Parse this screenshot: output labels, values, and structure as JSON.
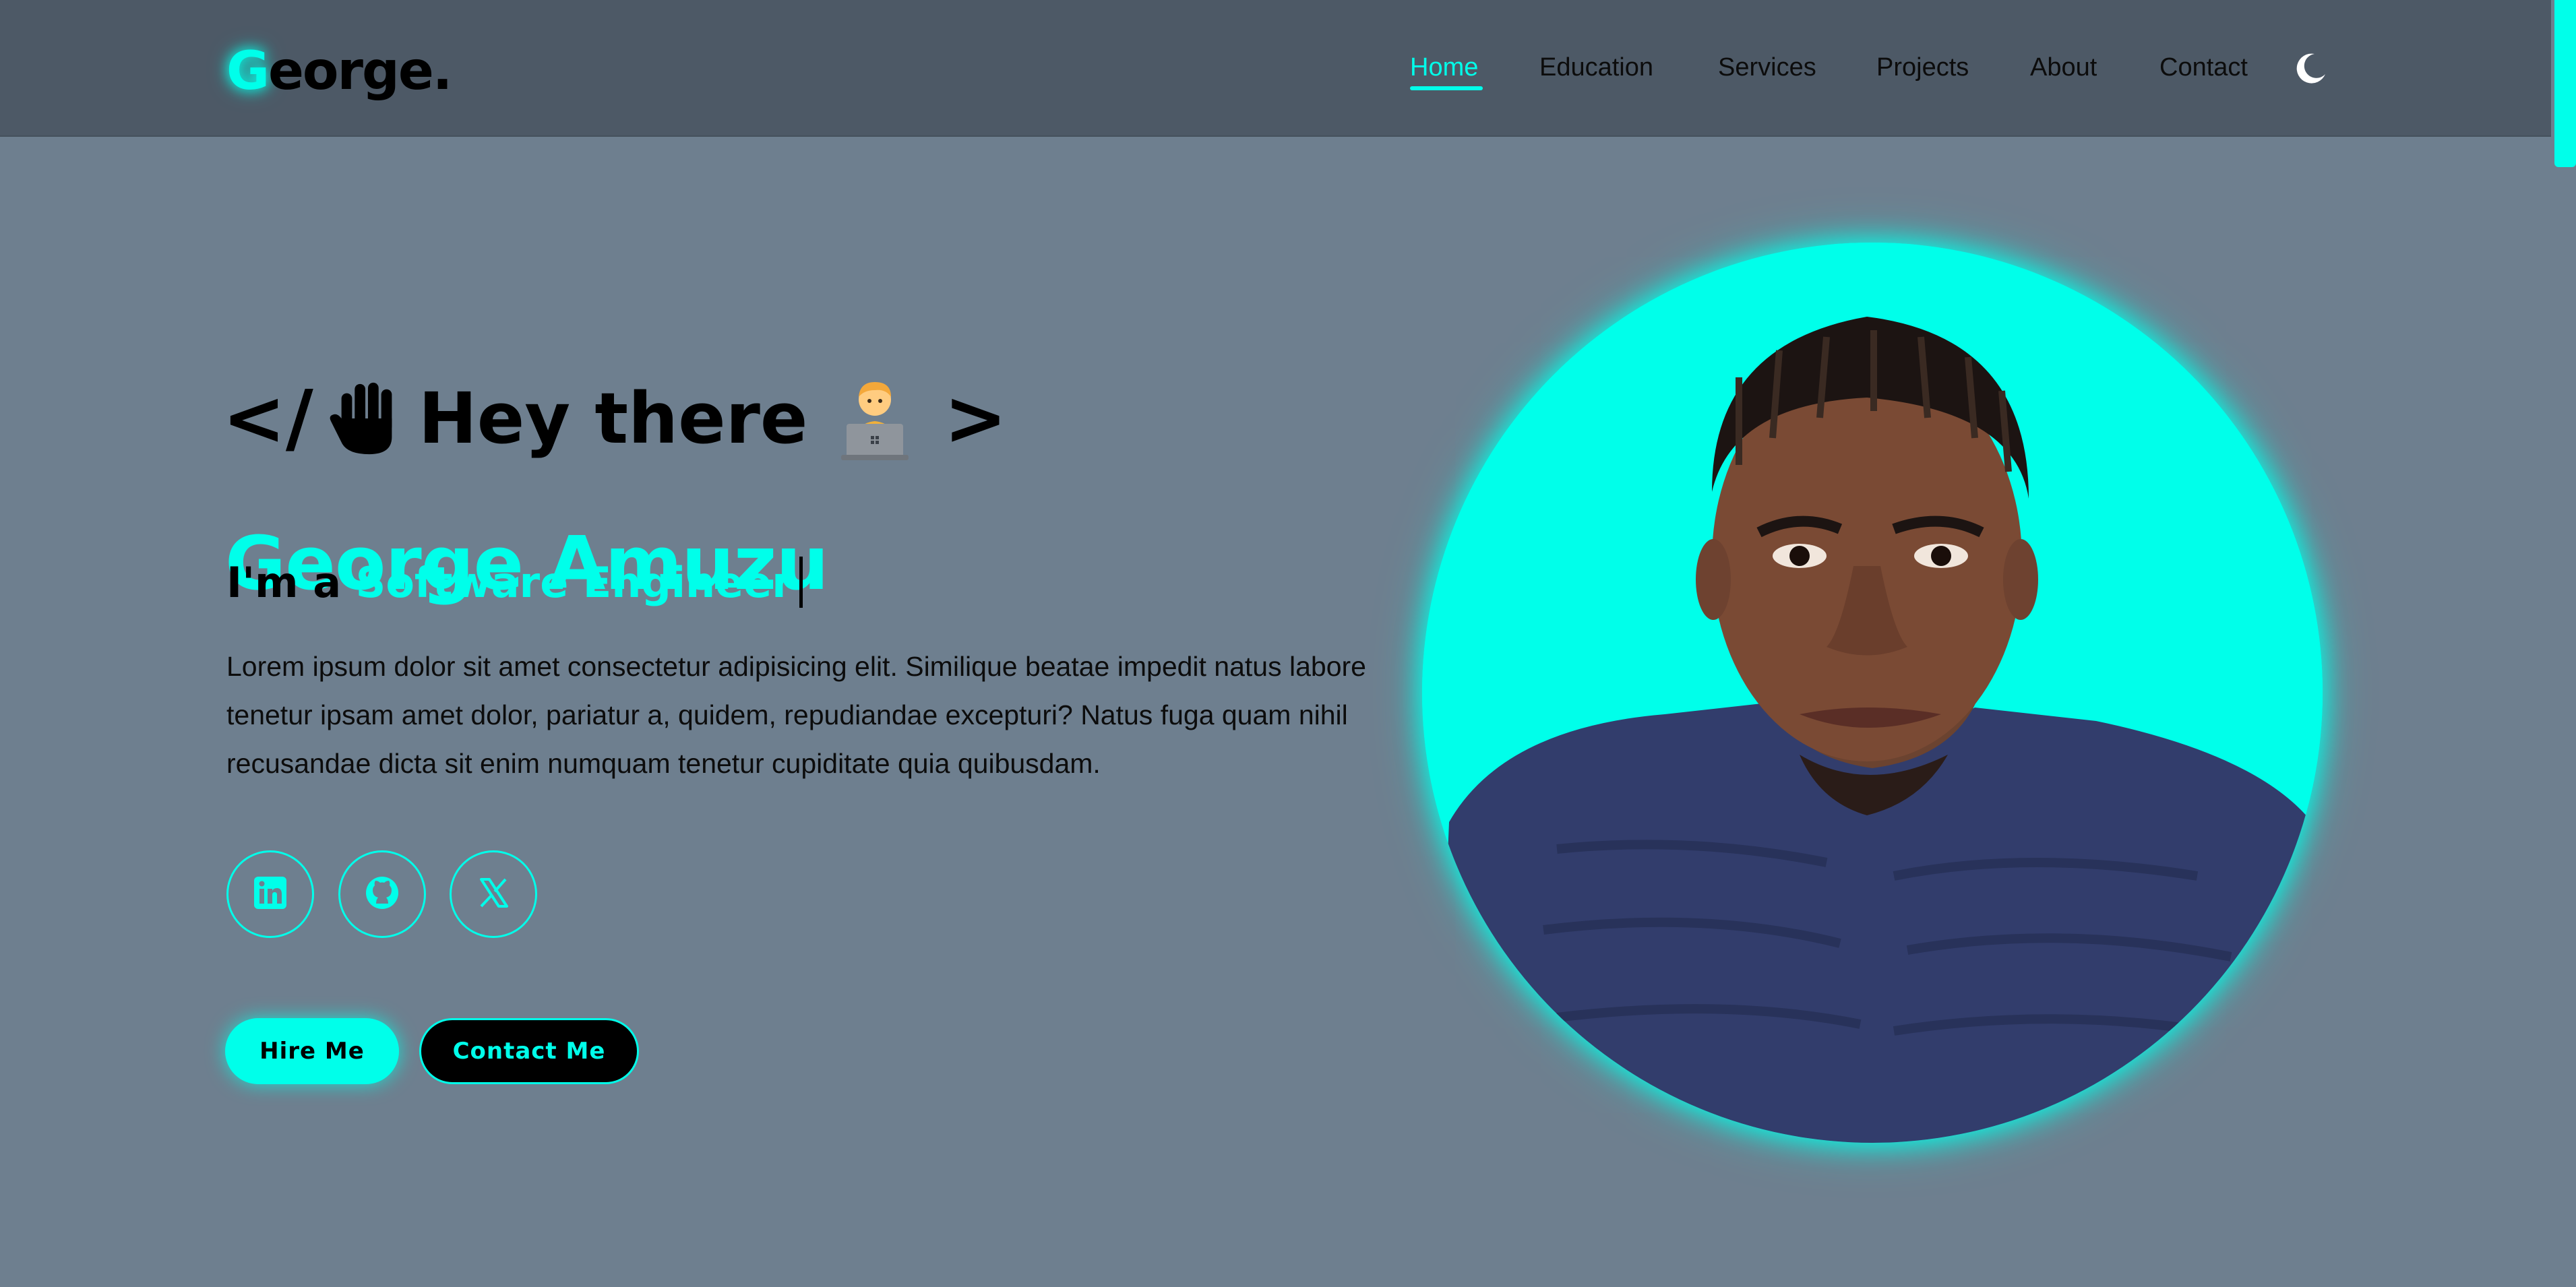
{
  "header": {
    "logo_initial": "G",
    "logo_rest": "eorge."
  },
  "nav": {
    "items": [
      {
        "label": "Home",
        "active": true
      },
      {
        "label": "Education",
        "active": false
      },
      {
        "label": "Services",
        "active": false
      },
      {
        "label": "Projects",
        "active": false
      },
      {
        "label": "About",
        "active": false
      },
      {
        "label": "Contact",
        "active": false
      }
    ],
    "theme_toggle_icon": "moon-icon"
  },
  "hero": {
    "bracket_open": "</",
    "bracket_close": ">",
    "greeting": "Hey there",
    "greeting_icons": [
      "raised-hand-icon",
      "technologist-icon"
    ],
    "name": "George Amuzu",
    "role_prefix": "I'm a",
    "role": "Software Engineer",
    "description": "Lorem ipsum dolor sit amet consectetur adipisicing elit. Similique beatae impedit natus labore tenetur ipsam amet dolor, pariatur a, quidem, repudiandae excepturi? Natus fuga quam nihil recusandae dicta sit enim numquam tenetur cupiditate quia quibusdam."
  },
  "social": [
    {
      "icon": "linkedin-icon"
    },
    {
      "icon": "github-icon"
    },
    {
      "icon": "x-twitter-icon"
    }
  ],
  "buttons": {
    "hire": "Hire Me",
    "contact": "Contact Me"
  },
  "colors": {
    "accent": "#00ffea",
    "background": "#6e7f8f",
    "header_bg": "#4d5966",
    "text": "#000000"
  }
}
